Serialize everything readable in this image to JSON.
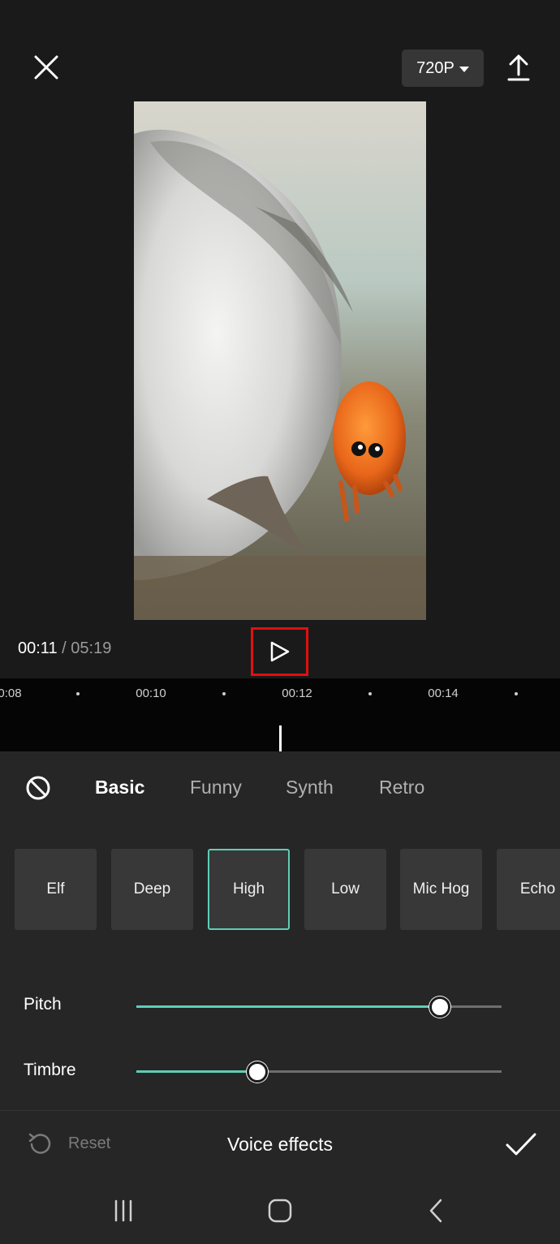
{
  "header": {
    "close_icon": "close-icon",
    "resolution_label": "720P",
    "export_icon": "upload-icon"
  },
  "playback": {
    "current_time": "00:11",
    "separator": "/",
    "total_time": "05:19",
    "play_icon": "play-icon"
  },
  "timeline": {
    "ticks": [
      "0:08",
      "00:10",
      "00:12",
      "00:14"
    ]
  },
  "categories": {
    "none_icon": "no-effect-icon",
    "tabs": [
      "Basic",
      "Funny",
      "Synth",
      "Retro"
    ],
    "active": "Basic"
  },
  "effects": {
    "items": [
      "Elf",
      "Deep",
      "High",
      "Low",
      "Mic Hog",
      "Echo"
    ],
    "selected": "High",
    "accent_color": "#5ecdb6"
  },
  "sliders": {
    "pitch": {
      "label": "Pitch",
      "value_percent": 83
    },
    "timbre": {
      "label": "Timbre",
      "value_percent": 33
    }
  },
  "footer": {
    "reset_label": "Reset",
    "title": "Voice effects",
    "confirm_icon": "checkmark-icon"
  },
  "navbar": {
    "recents_icon": "recents-icon",
    "home_icon": "home-icon",
    "back_icon": "back-icon"
  }
}
